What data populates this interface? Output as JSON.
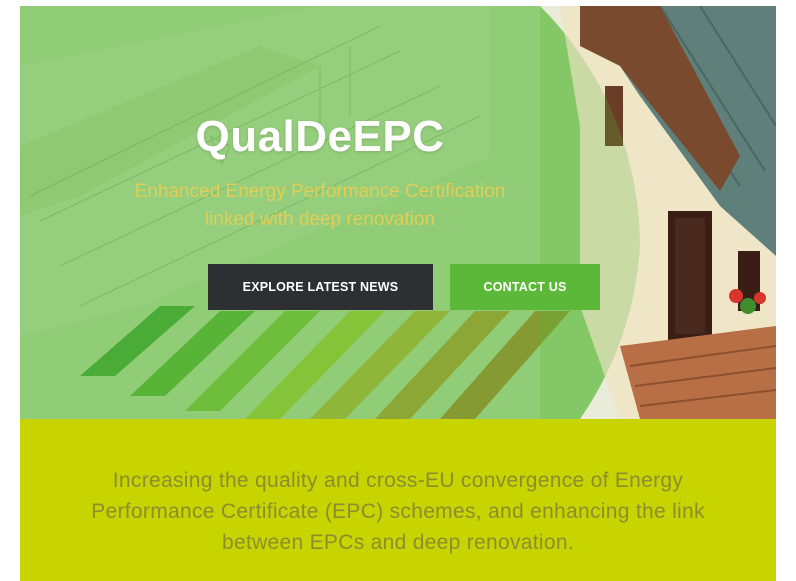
{
  "hero": {
    "title": "QualDeEPC",
    "subtitle_line1": "Enhanced Energy Performance Certification",
    "subtitle_line2": "linked with deep renovation"
  },
  "buttons": {
    "news_label": "EXPLORE LATEST NEWS",
    "contact_label": "CONTACT US"
  },
  "banner": {
    "line1": "Increasing the quality and cross-EU convergence of Energy",
    "line2": "Performance Certificate (EPC) schemes, and enhancing the link",
    "line3": "between EPCs and deep renovation."
  },
  "colors": {
    "overlay_green": "#5cb839",
    "dark_button": "#2d2f33",
    "banner_yellow": "#c7d400",
    "banner_text": "#8c8e2e",
    "subtitle_gold": "#e6cf55"
  }
}
